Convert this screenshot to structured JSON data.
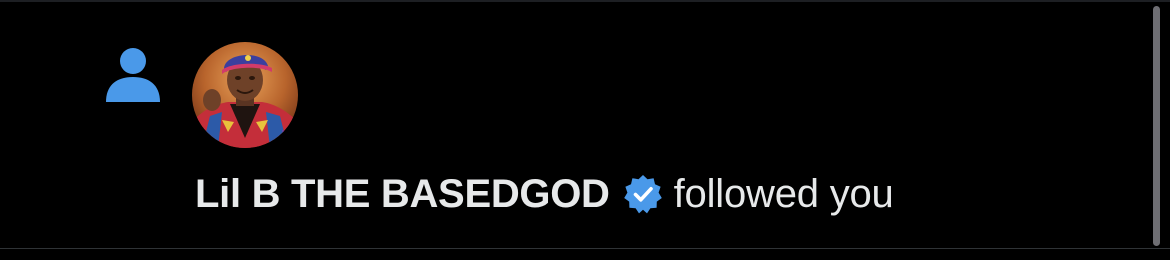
{
  "notification": {
    "type_icon": "person-icon",
    "avatar": "user-avatar",
    "username": "Lil B THE BASEDGOD",
    "verified_icon": "verified-badge-icon",
    "action": "followed you"
  },
  "colors": {
    "background": "#000000",
    "text": "#e7e9ea",
    "accent": "#4a99e9",
    "divider": "#2f3336"
  }
}
